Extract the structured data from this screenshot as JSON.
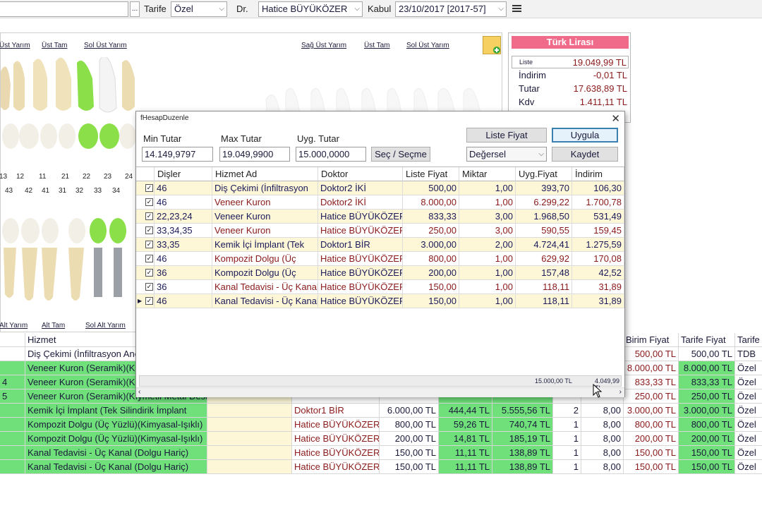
{
  "topbar": {
    "tarife_label": "Tarife",
    "tarife_value": "Özel",
    "dr_label": "Dr.",
    "dr_value": "Hatice BÜYÜKÖZER",
    "kabul_label": "Kabul",
    "kabul_value": "23/10/2017 [2017-57]",
    "ellipsis": "..."
  },
  "teeth": {
    "upper_links_left": [
      "Üst Yarım",
      "Üst Tam",
      "Sol Üst Yarım"
    ],
    "upper_links_right": [
      "Sağ Üst Yarım",
      "Üst Tam",
      "Sol Üst Yarım"
    ],
    "lower_links_left": [
      "Alt Yarım",
      "Alt Tam",
      "Sol Alt Yarım"
    ],
    "upper_numbers": [
      "13",
      "12",
      "11",
      "21",
      "22",
      "23",
      "24"
    ],
    "lower_numbers": [
      "43",
      "42",
      "41",
      "31",
      "32",
      "33",
      "34"
    ]
  },
  "summary": {
    "currency": "Türk Lirası",
    "rows": [
      {
        "label": "Liste",
        "value": "19.049,99 TL"
      },
      {
        "label": "İndirim",
        "value": "-0,01 TL"
      },
      {
        "label": "Tutar",
        "value": "17.638,89 TL"
      },
      {
        "label": "Kdv",
        "value": "1.411,11 TL"
      }
    ]
  },
  "dialog": {
    "title": "fHesapDuzenle",
    "min_label": "Min Tutar",
    "max_label": "Max Tutar",
    "uyg_label": "Uyg. Tutar",
    "min_value": "14.149,9797",
    "max_value": "19.049,9900",
    "uyg_value": "15.000,0000",
    "sec_button": "Seç / Seçme",
    "liste_fiyat_button": "Liste Fiyat",
    "uygula_button": "Uygula",
    "degersel_select": "Değersel",
    "kaydet_button": "Kaydet",
    "columns": [
      "Dişler",
      "Hizmet Ad",
      "Doktor",
      "Liste Fiyat",
      "Miktar",
      "Uyg.Fiyat",
      "İndirim"
    ],
    "rows": [
      {
        "disler": "46",
        "hizmet": "Diş Çekimi (İnfiltrasyon",
        "doktor": "Doktor2 İKİ",
        "liste": "500,00",
        "miktar": "1,00",
        "uyg": "393,70",
        "indirim": "106,30"
      },
      {
        "disler": "46",
        "hizmet": "Veneer Kuron",
        "doktor": "Doktor2 İKİ",
        "liste": "8.000,00",
        "miktar": "1,00",
        "uyg": "6.299,22",
        "indirim": "1.700,78"
      },
      {
        "disler": "22,23,24",
        "hizmet": "Veneer Kuron",
        "doktor": "Hatice BÜYÜKÖZER",
        "liste": "833,33",
        "miktar": "3,00",
        "uyg": "1.968,50",
        "indirim": "531,49"
      },
      {
        "disler": "33,34,35",
        "hizmet": "Veneer Kuron",
        "doktor": "Hatice BÜYÜKÖZER",
        "liste": "250,00",
        "miktar": "3,00",
        "uyg": "590,55",
        "indirim": "159,45"
      },
      {
        "disler": "33,35",
        "hizmet": "Kemik İçi İmplant (Tek",
        "doktor": "Doktor1 BİR",
        "liste": "3.000,00",
        "miktar": "2,00",
        "uyg": "4.724,41",
        "indirim": "1.275,59"
      },
      {
        "disler": "46",
        "hizmet": "Kompozit Dolgu (Üç",
        "doktor": "Hatice BÜYÜKÖZER",
        "liste": "800,00",
        "miktar": "1,00",
        "uyg": "629,92",
        "indirim": "170,08"
      },
      {
        "disler": "36",
        "hizmet": "Kompozit Dolgu (Üç",
        "doktor": "Hatice BÜYÜKÖZER",
        "liste": "200,00",
        "miktar": "1,00",
        "uyg": "157,48",
        "indirim": "42,52"
      },
      {
        "disler": "36",
        "hizmet": "Kanal Tedavisi - Üç Kanal",
        "doktor": "Hatice BÜYÜKÖZER",
        "liste": "150,00",
        "miktar": "1,00",
        "uyg": "118,11",
        "indirim": "31,89"
      },
      {
        "disler": "46",
        "hizmet": "Kanal Tedavisi - Üç Kanal",
        "doktor": "Hatice BÜYÜKÖZER",
        "liste": "150,00",
        "miktar": "1,00",
        "uyg": "118,11",
        "indirim": "31,89"
      }
    ],
    "footer_total_uyg": "15.000,00 TL",
    "footer_total_indirim": "4.049,99 TL"
  },
  "bottom_grid": {
    "headers": {
      "hizmet": "Hizmet",
      "birim": "Birim Fiyat",
      "tarife_fiyat": "Tarife Fiyat",
      "tarife": "Tarife"
    },
    "rows": [
      {
        "dis": "",
        "hizmet": "Diş Çekimi (İnfiltrasyon Ane",
        "doktor": "",
        "c1": "",
        "c2": "",
        "c3": "",
        "adet": "",
        "kdv": "",
        "birim": "500,00 TL",
        "tfiyat": "500,00 TL",
        "tarife": "TDB",
        "color": "w"
      },
      {
        "dis": "",
        "hizmet": "Veneer Kuron (Seramik)(Kıy",
        "doktor": "",
        "c1": "",
        "c2": "",
        "c3": "",
        "adet": "",
        "kdv": "",
        "birim": "8.000,00 TL",
        "tfiyat": "8.000,00 TL",
        "tarife": "Özel",
        "color": "g"
      },
      {
        "dis": "4",
        "hizmet": "Veneer Kuron (Seramik)(Kıy",
        "doktor": "",
        "c1": "",
        "c2": "",
        "c3": "",
        "adet": "",
        "kdv": "",
        "birim": "833,33 TL",
        "tfiyat": "833,33 TL",
        "tarife": "Özel",
        "color": "g"
      },
      {
        "dis": "5",
        "hizmet": "Veneer Kuron (Seramik)(Kıymetli Metal Dest",
        "doktor": "",
        "c1": "",
        "c2": "",
        "c3": "",
        "adet": "",
        "kdv": "",
        "birim": "250,00 TL",
        "tfiyat": "250,00 TL",
        "tarife": "Özel",
        "color": "g"
      },
      {
        "dis": "",
        "hizmet": "Kemik İçi İmplant (Tek Silindirik İmplant",
        "doktor": "Doktor1 BİR",
        "c1": "6.000,00 TL",
        "c2": "444,44 TL",
        "c3": "5.555,56 TL",
        "adet": "2",
        "kdv": "8,00",
        "birim": "3.000,00 TL",
        "tfiyat": "3.000,00 TL",
        "tarife": "Özel",
        "color": "g"
      },
      {
        "dis": "",
        "hizmet": "Kompozit Dolgu (Üç Yüzlü)(Kimyasal-Işıklı)",
        "doktor": "Hatice BÜYÜKÖZER",
        "c1": "800,00 TL",
        "c2": "59,26 TL",
        "c3": "740,74 TL",
        "adet": "1",
        "kdv": "8,00",
        "birim": "800,00 TL",
        "tfiyat": "800,00 TL",
        "tarife": "Özel",
        "color": "g"
      },
      {
        "dis": "",
        "hizmet": "Kompozit Dolgu (Üç Yüzlü)(Kimyasal-Işıklı)",
        "doktor": "Hatice BÜYÜKÖZER",
        "c1": "200,00 TL",
        "c2": "14,81 TL",
        "c3": "185,19 TL",
        "adet": "1",
        "kdv": "8,00",
        "birim": "200,00 TL",
        "tfiyat": "200,00 TL",
        "tarife": "Özel",
        "color": "g"
      },
      {
        "dis": "",
        "hizmet": "Kanal Tedavisi - Üç Kanal (Dolgu Hariç)",
        "doktor": "Hatice BÜYÜKÖZER",
        "c1": "150,00 TL",
        "c2": "11,11 TL",
        "c3": "138,89 TL",
        "adet": "1",
        "kdv": "8,00",
        "birim": "150,00 TL",
        "tfiyat": "150,00 TL",
        "tarife": "Özel",
        "color": "g"
      },
      {
        "dis": "",
        "hizmet": "Kanal Tedavisi - Üç Kanal (Dolgu Hariç)",
        "doktor": "Hatice BÜYÜKÖZER",
        "c1": "150,00 TL",
        "c2": "11,11 TL",
        "c3": "138,89 TL",
        "adet": "1",
        "kdv": "8,00",
        "birim": "150,00 TL",
        "tfiyat": "150,00 TL",
        "tarife": "Özel",
        "color": "g"
      }
    ]
  },
  "colors": {
    "green": "#6fe07a",
    "tooth_green": "#8be04a",
    "row_yellow": "#fdf7d8",
    "currency_pink": "#f06a8a",
    "primary_blue": "#3c7fb1"
  }
}
